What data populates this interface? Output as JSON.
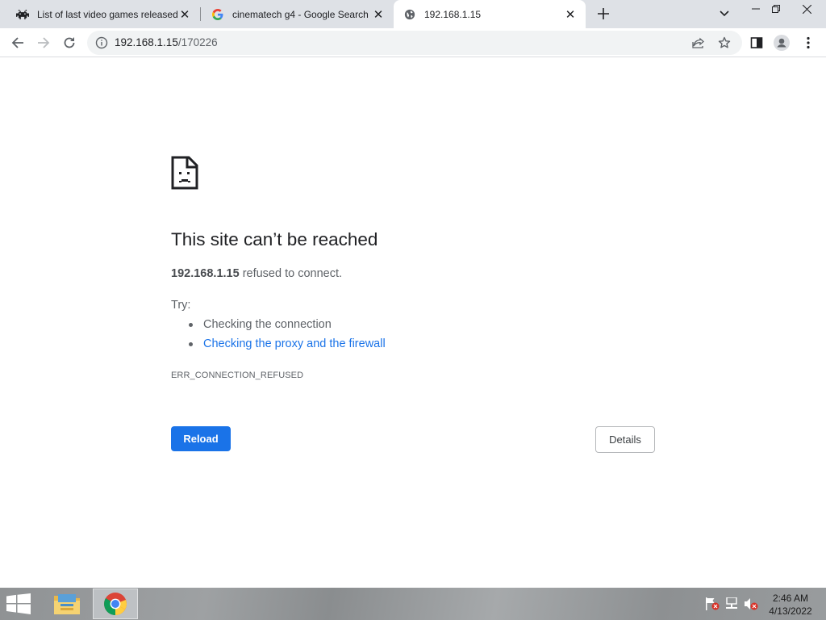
{
  "tabs": [
    {
      "title": "List of last video games released",
      "favicon": "space-invader-icon",
      "active": false
    },
    {
      "title": "cinematech g4 - Google Search",
      "favicon": "google-g-icon",
      "active": false
    },
    {
      "title": "192.168.1.15",
      "favicon": "globe-icon",
      "active": true
    }
  ],
  "window_controls": {
    "minimize": "–",
    "restore": "❐",
    "close": "✕"
  },
  "toolbar": {
    "url_host": "192.168.1.15",
    "url_path": "/170226"
  },
  "error_page": {
    "heading": "This site can’t be reached",
    "host": "192.168.1.15",
    "summary_suffix": " refused to connect.",
    "try_label": "Try:",
    "suggestions": [
      {
        "text": "Checking the connection",
        "is_link": false
      },
      {
        "text": "Checking the proxy and the firewall",
        "is_link": true
      }
    ],
    "error_code": "ERR_CONNECTION_REFUSED",
    "reload_label": "Reload",
    "details_label": "Details"
  },
  "taskbar": {
    "apps": [
      "file-explorer-icon",
      "chrome-icon"
    ],
    "tray": [
      "action-center-flag-icon",
      "network-icon",
      "volume-muted-icon"
    ],
    "time": "2:46 AM",
    "date": "4/13/2022"
  },
  "colors": {
    "accent": "#1a73e8",
    "tabstrip": "#dee1e6",
    "text": "#202124",
    "muted": "#5f6368"
  }
}
